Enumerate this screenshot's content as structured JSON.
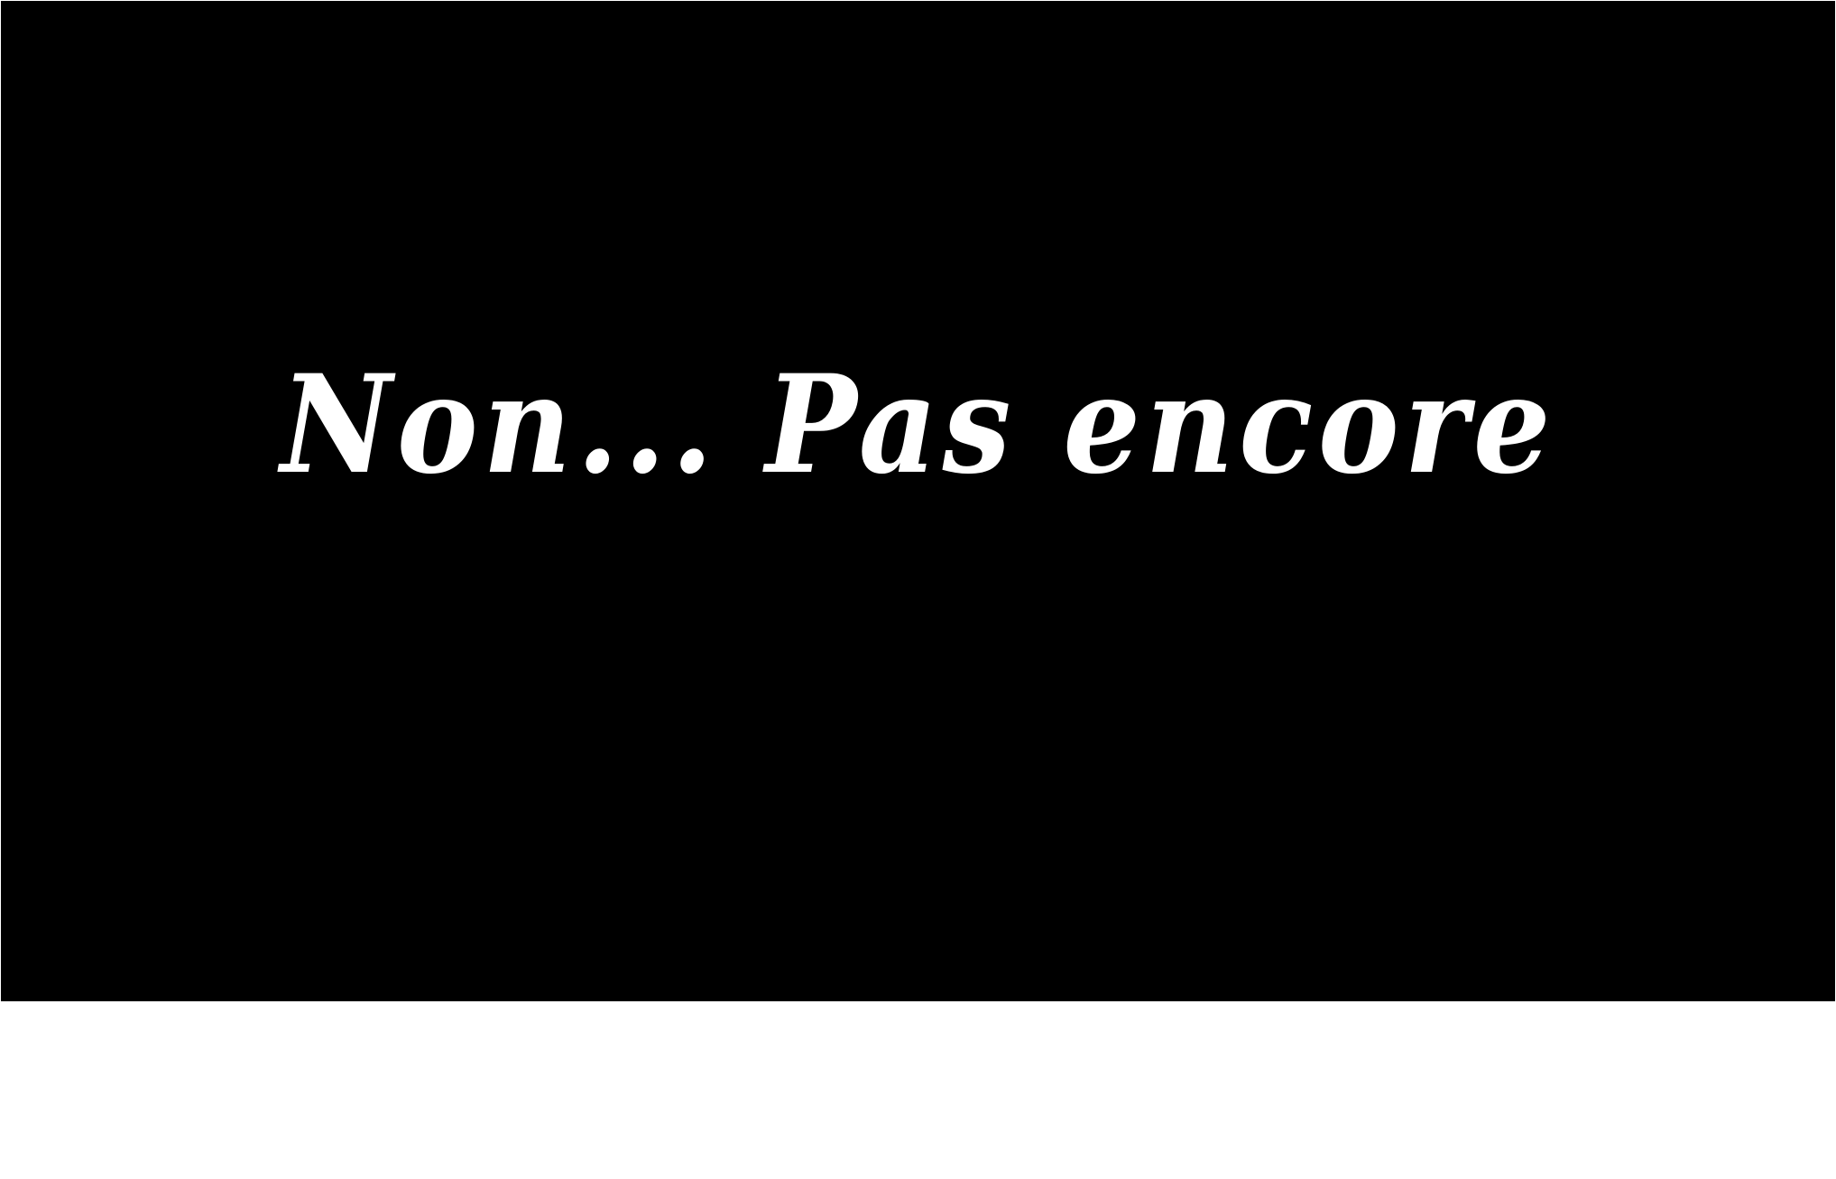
{
  "screen": {
    "message": "Non... Pas encore"
  },
  "colors": {
    "background": "#000000",
    "text": "#ffffff",
    "page": "#ffffff"
  }
}
